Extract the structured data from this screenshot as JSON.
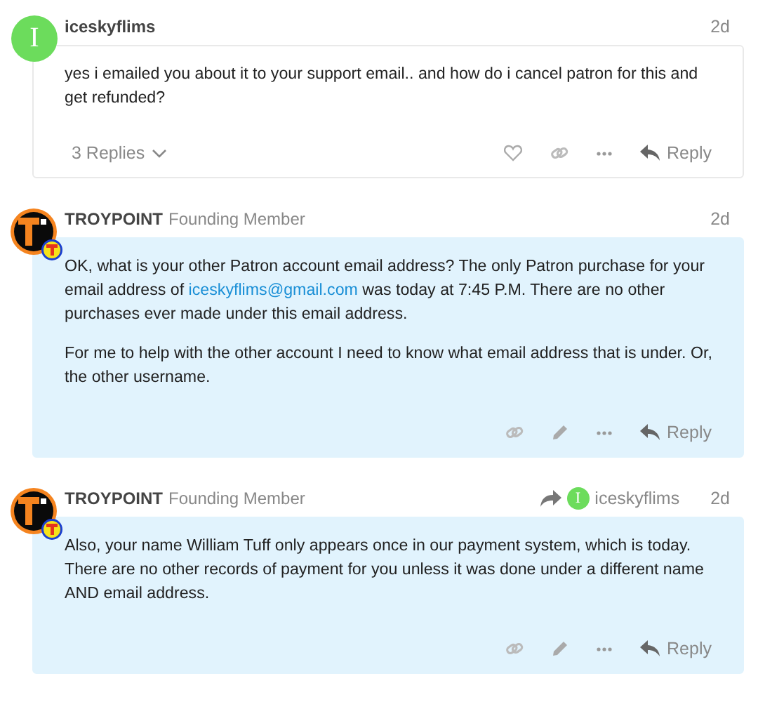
{
  "posts": [
    {
      "avatar": {
        "kind": "letter",
        "letter": "I"
      },
      "username": "iceskyflims",
      "date": "2d",
      "highlighted": false,
      "paragraphs": [
        [
          {
            "kind": "text",
            "text": "yes i emailed you about it to your support email.. and how do i cancel patron for this and get refunded?"
          }
        ]
      ],
      "replies": "3 Replies",
      "actions": [
        {
          "kind": "like"
        },
        {
          "kind": "link"
        },
        {
          "kind": "more"
        },
        {
          "kind": "reply",
          "label": "Reply"
        }
      ]
    },
    {
      "avatar": {
        "kind": "logo"
      },
      "username": "TROYPOINT",
      "title": "Founding Member",
      "date": "2d",
      "highlighted": true,
      "paragraphs": [
        [
          {
            "kind": "text",
            "text": "OK, what is your other Patron account email address? The only Patron purchase for your email address of "
          },
          {
            "kind": "link",
            "text": "iceskyflims@gmail.com"
          },
          {
            "kind": "text",
            "text": " was today at 7:45 P.M. There are no other purchases ever made under this email address."
          }
        ],
        [
          {
            "kind": "text",
            "text": "For me to help with the other account I need to know what email address that is under. Or, the other username."
          }
        ]
      ],
      "actions": [
        {
          "kind": "link"
        },
        {
          "kind": "edit"
        },
        {
          "kind": "more"
        },
        {
          "kind": "reply",
          "label": "Reply"
        }
      ]
    },
    {
      "avatar": {
        "kind": "logo"
      },
      "username": "TROYPOINT",
      "title": "Founding Member",
      "date": "2d",
      "highlighted": true,
      "reply_to": {
        "letter": "I",
        "username": "iceskyflims"
      },
      "paragraphs": [
        [
          {
            "kind": "text",
            "text": "Also, your name William Tuff only appears once in our payment system, which is today. There are no other records of payment for you unless it was done under a different name AND email address."
          }
        ]
      ],
      "actions": [
        {
          "kind": "link"
        },
        {
          "kind": "edit"
        },
        {
          "kind": "more"
        },
        {
          "kind": "reply",
          "label": "Reply"
        }
      ]
    }
  ]
}
